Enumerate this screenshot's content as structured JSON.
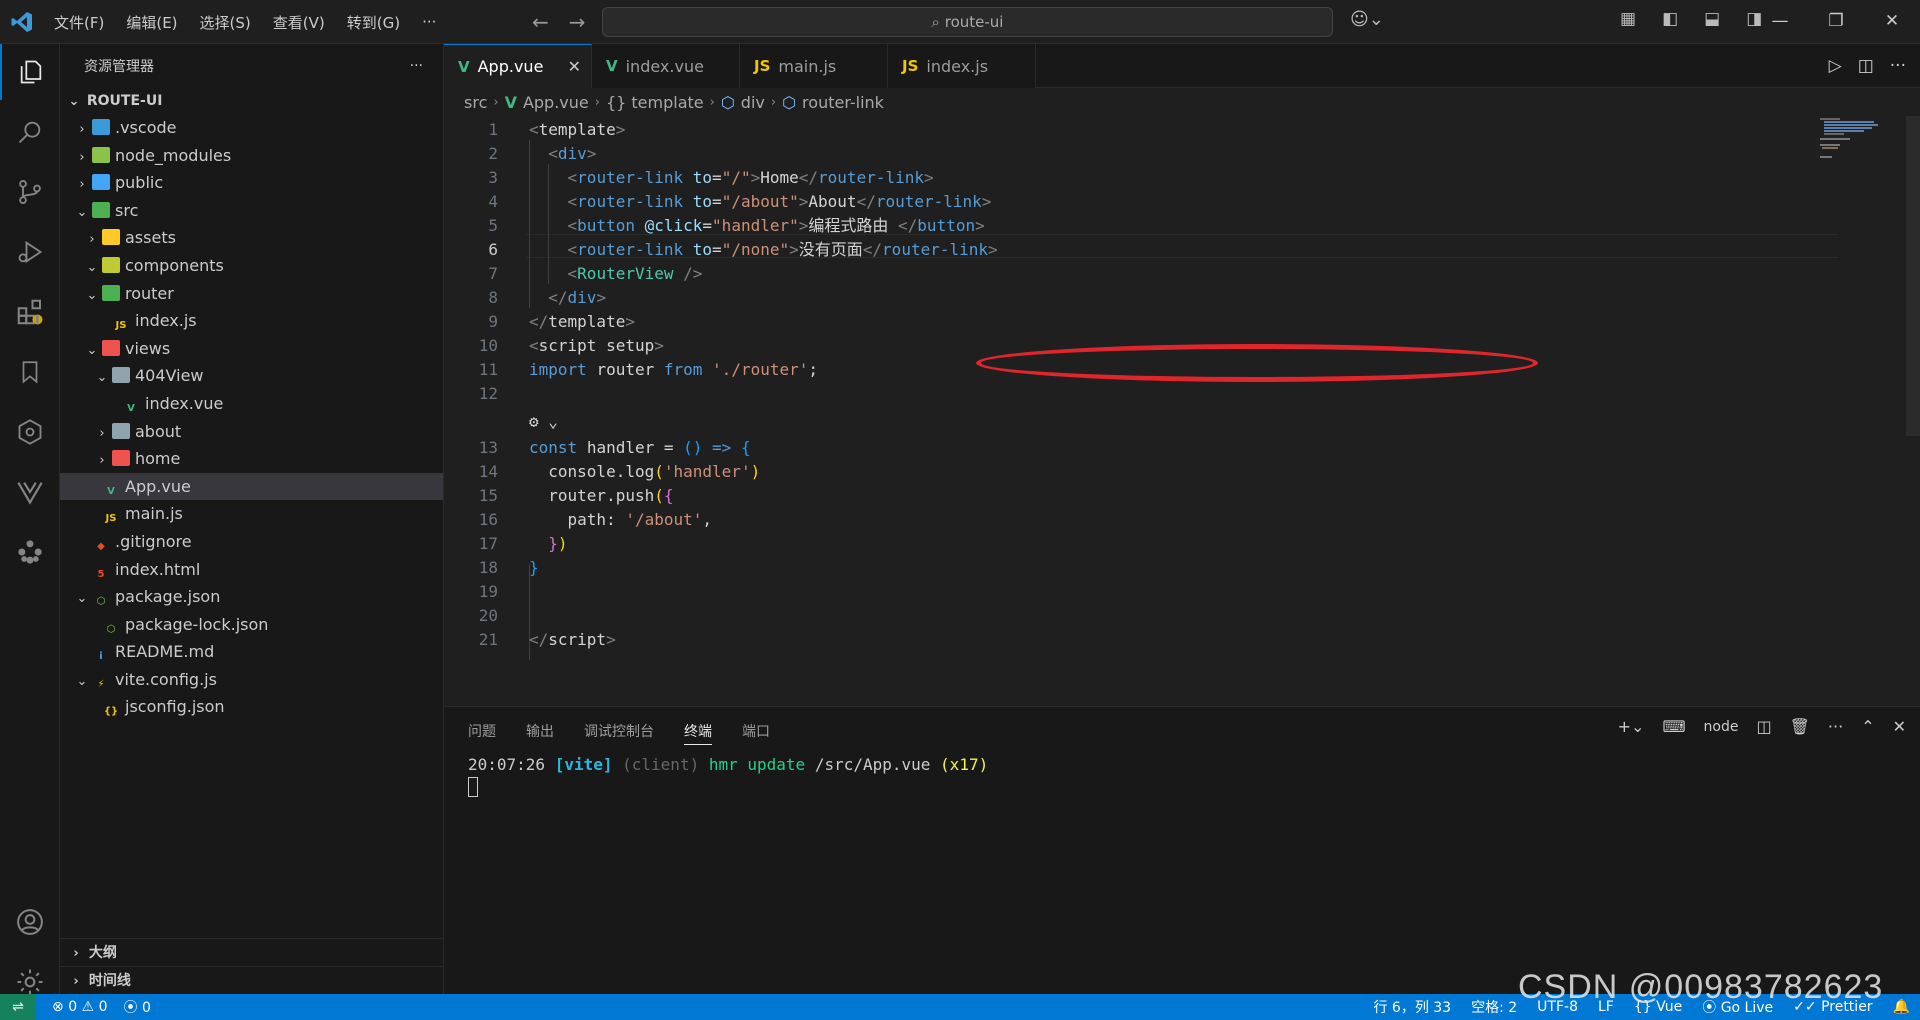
{
  "titlebar": {
    "menu": [
      "文件(F)",
      "编辑(E)",
      "选择(S)",
      "查看(V)",
      "转到(G)",
      "···"
    ],
    "search": "route-ui"
  },
  "explorer": {
    "title": "资源管理器",
    "more": "···",
    "root": "ROUTE-UI",
    "items": [
      {
        "label": ".vscode",
        "icon": "folder-vscode-icon",
        "color": "#3c9ad8",
        "depth": 0,
        "chev": "›"
      },
      {
        "label": "node_modules",
        "icon": "folder-node-icon",
        "color": "#8bc34a",
        "depth": 0,
        "chev": "›"
      },
      {
        "label": "public",
        "icon": "folder-public-icon",
        "color": "#42a5f5",
        "depth": 0,
        "chev": "›"
      },
      {
        "label": "src",
        "icon": "folder-src-icon",
        "color": "#4caf50",
        "depth": 0,
        "chev": "⌄"
      },
      {
        "label": "assets",
        "icon": "folder-assets-icon",
        "color": "#ffca28",
        "depth": 1,
        "chev": "›"
      },
      {
        "label": "components",
        "icon": "folder-components-icon",
        "color": "#c0ca33",
        "depth": 1,
        "chev": "⌄"
      },
      {
        "label": "router",
        "icon": "folder-router-icon",
        "color": "#4caf50",
        "depth": 1,
        "chev": "⌄"
      },
      {
        "label": "index.js",
        "icon": "js-file-icon",
        "color": "#f1c40f",
        "depth": 2,
        "chev": ""
      },
      {
        "label": "views",
        "icon": "folder-views-icon",
        "color": "#ef5350",
        "depth": 1,
        "chev": "⌄"
      },
      {
        "label": "404View",
        "icon": "folder-open-icon",
        "color": "#90a4ae",
        "depth": 2,
        "chev": "⌄"
      },
      {
        "label": "index.vue",
        "icon": "vue-file-icon",
        "color": "#41b883",
        "depth": 3,
        "chev": ""
      },
      {
        "label": "about",
        "icon": "folder-icon",
        "color": "#90a4ae",
        "depth": 2,
        "chev": "›"
      },
      {
        "label": "home",
        "icon": "folder-home-icon",
        "color": "#ef5350",
        "depth": 2,
        "chev": "›"
      },
      {
        "label": "App.vue",
        "icon": "vue-file-icon",
        "color": "#41b883",
        "depth": 1,
        "chev": "",
        "selected": true
      },
      {
        "label": "main.js",
        "icon": "js-file-icon",
        "color": "#f1c40f",
        "depth": 1,
        "chev": ""
      },
      {
        "label": ".gitignore",
        "icon": "git-icon",
        "color": "#e44d26",
        "depth": 0,
        "chev": ""
      },
      {
        "label": "index.html",
        "icon": "html-file-icon",
        "color": "#e44d26",
        "depth": 0,
        "chev": ""
      },
      {
        "label": "package.json",
        "icon": "nodejs-icon",
        "color": "#8bc34a",
        "depth": 0,
        "chev": "⌄"
      },
      {
        "label": "package-lock.json",
        "icon": "nodejs-icon",
        "color": "#8bc34a",
        "depth": 1,
        "chev": ""
      },
      {
        "label": "README.md",
        "icon": "info-icon",
        "color": "#42a5f5",
        "depth": 0,
        "chev": ""
      },
      {
        "label": "vite.config.js",
        "icon": "vite-icon",
        "color": "#ffc107",
        "depth": 0,
        "chev": "⌄"
      },
      {
        "label": "jsconfig.json",
        "icon": "json-file-icon",
        "color": "#f1c40f",
        "depth": 1,
        "chev": ""
      }
    ],
    "outline": "大纲",
    "timeline": "时间线"
  },
  "tabs": [
    {
      "label": "App.vue",
      "icon": "vue-file-icon",
      "glyph": "V",
      "color": "#41b883",
      "active": true
    },
    {
      "label": "index.vue",
      "icon": "vue-file-icon",
      "glyph": "V",
      "color": "#41b883",
      "active": false
    },
    {
      "label": "main.js",
      "icon": "js-file-icon",
      "glyph": "JS",
      "color": "#f1c40f",
      "active": false
    },
    {
      "label": "index.js",
      "icon": "js-file-icon",
      "glyph": "JS",
      "color": "#f1c40f",
      "active": false
    }
  ],
  "breadcrumb": [
    "src",
    "App.vue",
    "{} template",
    "div",
    "router-link"
  ],
  "editor": {
    "current_line": 6,
    "lines": [
      {
        "n": "1",
        "html": "<span class='t-tag'>&lt;</span><span class='t-txt'>template</span><span class='t-tag'>&gt;</span>"
      },
      {
        "n": "2",
        "html": "  <span class='t-tag'>&lt;</span><span class='t-name'>div</span><span class='t-tag'>&gt;</span>"
      },
      {
        "n": "3",
        "html": "    <span class='t-tag'>&lt;</span><span class='t-name'>router-link</span> <span class='t-attr'>to</span><span class='t-txt'>=</span><span class='t-str'>\"/\"</span><span class='t-tag'>&gt;</span><span class='t-txt'>Home</span><span class='t-tag'>&lt;/</span><span class='t-name'>router-link</span><span class='t-tag'>&gt;</span>"
      },
      {
        "n": "4",
        "html": "    <span class='t-tag'>&lt;</span><span class='t-name'>router-link</span> <span class='t-attr'>to</span><span class='t-txt'>=</span><span class='t-str'>\"/about\"</span><span class='t-tag'>&gt;</span><span class='t-txt'>About</span><span class='t-tag'>&lt;/</span><span class='t-name'>router-link</span><span class='t-tag'>&gt;</span>"
      },
      {
        "n": "5",
        "html": "    <span class='t-tag'>&lt;</span><span class='t-name'>button</span> <span class='t-attr'>@click</span><span class='t-txt'>=</span><span class='t-str'>\"handler\"</span><span class='t-tag'>&gt;</span><span class='t-txt'>编程式路由 </span><span class='t-tag'>&lt;/</span><span class='t-name'>button</span><span class='t-tag'>&gt;</span>"
      },
      {
        "n": "6",
        "html": "    <span class='t-tag'>&lt;</span><span class='t-name'>router-link</span> <span class='t-attr'>to</span><span class='t-txt'>=</span><span class='t-str'>\"/none\"</span><span class='t-tag'>&gt;</span><span class='t-txt'>没有页面</span><span class='t-tag'>&lt;/</span><span class='t-name'>router-link</span><span class='t-tag'>&gt;</span>"
      },
      {
        "n": "7",
        "html": "    <span class='t-tag'>&lt;</span><span class='t-comp'>RouterView</span> <span class='t-tag'>/&gt;</span>"
      },
      {
        "n": "8",
        "html": "  <span class='t-tag'>&lt;/</span><span class='t-name'>div</span><span class='t-tag'>&gt;</span>"
      },
      {
        "n": "9",
        "html": "<span class='t-tag'>&lt;/</span><span class='t-txt'>template</span><span class='t-tag'>&gt;</span>"
      },
      {
        "n": "10",
        "html": "<span class='t-tag'>&lt;</span><span class='t-txt'>script</span> <span class='t-txt'>setup</span><span class='t-tag'>&gt;</span>"
      },
      {
        "n": "11",
        "html": "<span class='t-kw'>import</span> <span class='t-txt'>router</span> <span class='t-kw'>from</span> <span class='t-str'>'./router'</span><span class='t-txt'>;</span>"
      },
      {
        "n": "12",
        "html": ""
      },
      {
        "n": "",
        "html": "<span class='t-txt'>⚙ ⌄</span>"
      },
      {
        "n": "13",
        "html": "<span class='t-kw'>const</span> <span class='t-txt'>handler = </span><span class='t-br3'>()</span> <span class='t-kw'>=&gt;</span> <span class='t-br3'>{</span>"
      },
      {
        "n": "14",
        "html": "  <span class='t-txt'>console.log</span><span class='t-br1'>(</span><span class='t-str'>'handler'</span><span class='t-br1'>)</span>"
      },
      {
        "n": "15",
        "html": "  <span class='t-txt'>router.push</span><span class='t-br1'>(</span><span class='t-br2'>{</span>"
      },
      {
        "n": "16",
        "html": "    <span class='t-txt'>path: </span><span class='t-str'>'/about'</span><span class='t-txt'>,</span>"
      },
      {
        "n": "17",
        "html": "  <span class='t-br2'>}</span><span class='t-br1'>)</span>"
      },
      {
        "n": "18",
        "html": "<span class='t-br3'>}</span>"
      },
      {
        "n": "19",
        "html": ""
      },
      {
        "n": "20",
        "html": ""
      },
      {
        "n": "21",
        "html": "<span class='t-tag'>&lt;/</span><span class='t-txt'>script</span><span class='t-tag'>&gt;</span>"
      }
    ]
  },
  "panel": {
    "tabs": [
      "问题",
      "输出",
      "调试控制台",
      "终端",
      "端口"
    ],
    "active_tab": "终端",
    "terminal_kind": "node",
    "terminal": {
      "time": "20:07:26",
      "tag": "[vite]",
      "client": "(client)",
      "action": "hmr update",
      "path": "/src/App.vue",
      "count": "(x17)"
    }
  },
  "statusbar": {
    "errors": "0",
    "warnings": "0",
    "ports": "0",
    "position": "行 6，列 33",
    "spaces": "空格: 2",
    "encoding": "UTF-8",
    "eol": "LF",
    "language": "Vue",
    "golive": "Go Live",
    "prettier": "Prettier"
  },
  "watermark": "CSDN @00983782623"
}
